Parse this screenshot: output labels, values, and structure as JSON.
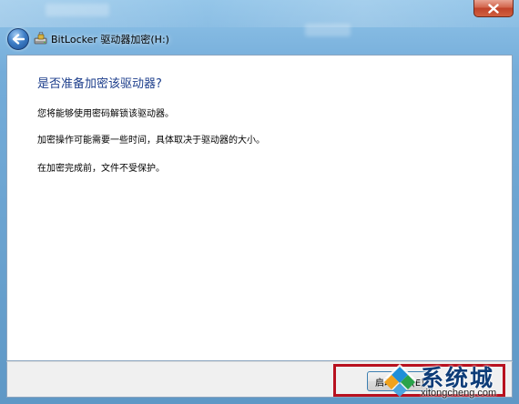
{
  "window": {
    "title": "BitLocker 驱动器加密(H:)",
    "close_icon": "close-icon",
    "back_icon": "back-arrow-icon",
    "app_icon": "bitlocker-drive-icon"
  },
  "content": {
    "heading": "是否准备加密该驱动器?",
    "paragraphs": [
      "您将能够使用密码解锁该驱动器。",
      "加密操作可能需要一些时间，具体取决于驱动器的大小。",
      "在加密完成前，文件不受保护。"
    ]
  },
  "footer": {
    "next_button_label": "启动加密(E)"
  },
  "watermark": {
    "text": "系统城",
    "url": "xitongcheng.com"
  },
  "colors": {
    "heading": "#1e3f8c",
    "highlight": "#b8111f",
    "frame": "#74acd9"
  }
}
